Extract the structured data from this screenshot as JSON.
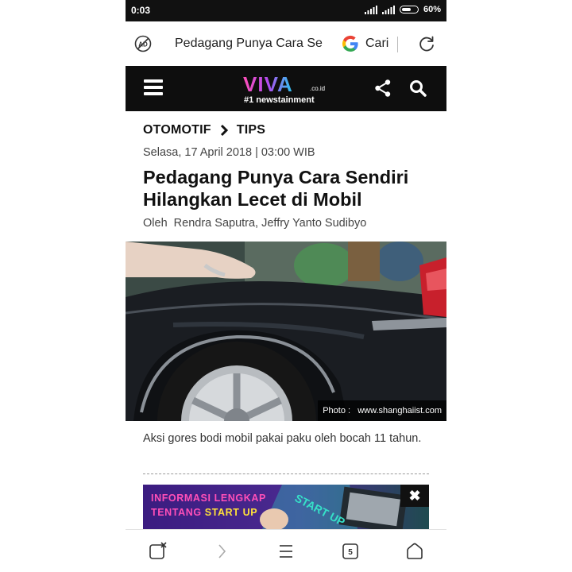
{
  "status_bar": {
    "time": "0:03",
    "battery": "60%"
  },
  "browser": {
    "url_text": "Pedagang Punya Cara Se",
    "search_label": "Cari"
  },
  "site": {
    "logo_text": "VIVA",
    "logo_domain": ".co.id",
    "tagline": "#1 newstainment"
  },
  "article": {
    "breadcrumb": [
      "OTOMOTIF",
      "TIPS"
    ],
    "date": "Selasa, 17 April 2018 | 03:00 WIB",
    "headline": "Pedagang Punya Cara Sendiri Hilangkan Lecet di Mobil",
    "author": "Oleh  Rendra Saputra, Jeffry Yanto Sudibyo",
    "photo_credit": "Photo :   www.shanghaiist.com",
    "caption": "Aksi gores bodi mobil pakai paku oleh bocah 11 tahun."
  },
  "ad": {
    "line1": "INFORMASI LENGKAP",
    "line2_prefix": "TENTANG ",
    "line2_highlight": "START UP",
    "sign_text": "START UP",
    "close": "✖"
  },
  "nav": {
    "tabs_count": "5"
  },
  "colors": {
    "header_bg": "#0e0e0e",
    "ad_pink": "#ff4fb8",
    "ad_yellow": "#ffe13a"
  }
}
